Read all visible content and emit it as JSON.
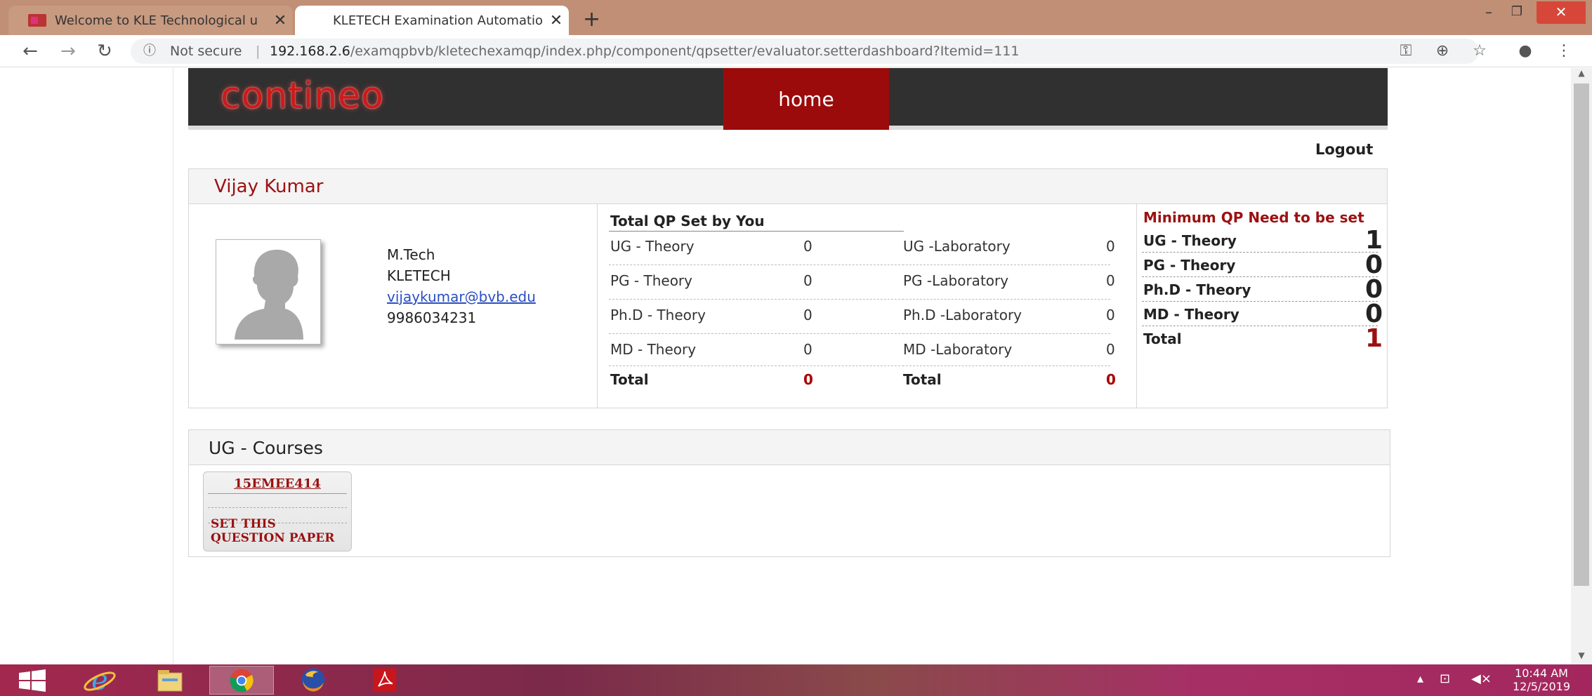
{
  "browser": {
    "tabs": [
      {
        "title": "Welcome to KLE Technological u",
        "close": "✕"
      },
      {
        "title": "KLETECH Examination Automatio",
        "close": "✕"
      }
    ],
    "new_tab": "+",
    "window": {
      "minimize": "–",
      "maximize": "❐",
      "close": "✕"
    },
    "security_label": "Not secure",
    "url_host": "192.168.2.6",
    "url_path": "/examqpbvb/kletechexamqp/index.php/component/qpsetter/evaluator.setterdashboard?Itemid=111"
  },
  "site": {
    "logo": "contineo",
    "nav_home": "home",
    "logout": "Logout"
  },
  "profile": {
    "name": "Vijay Kumar",
    "qualification": "M.Tech",
    "institution": "KLETECH",
    "email": "vijaykumar@bvb.edu",
    "phone": "9986034231"
  },
  "qp_set": {
    "title": "Total QP Set by You",
    "rows": [
      {
        "theory_label": "UG - Theory",
        "theory_value": "0",
        "lab_label": "UG -Laboratory",
        "lab_value": "0"
      },
      {
        "theory_label": "PG - Theory",
        "theory_value": "0",
        "lab_label": "PG -Laboratory",
        "lab_value": "0"
      },
      {
        "theory_label": "Ph.D - Theory",
        "theory_value": "0",
        "lab_label": "Ph.D -Laboratory",
        "lab_value": "0"
      },
      {
        "theory_label": "MD - Theory",
        "theory_value": "0",
        "lab_label": "MD -Laboratory",
        "lab_value": "0"
      }
    ],
    "total_label": "Total",
    "total_theory": "0",
    "total_lab": "0"
  },
  "minimum_qp": {
    "title": "Minimum QP Need to be set",
    "rows": [
      {
        "label": "UG - Theory",
        "value": "1"
      },
      {
        "label": "PG - Theory",
        "value": "0"
      },
      {
        "label": "Ph.D - Theory",
        "value": "0"
      },
      {
        "label": "MD - Theory",
        "value": "0"
      }
    ],
    "total_label": "Total",
    "total_value": "1"
  },
  "courses": {
    "title": "UG - Courses",
    "items": [
      {
        "code": "15EMEE414",
        "action": "SET THIS QUESTION PAPER"
      }
    ]
  },
  "taskbar": {
    "clock_time": "10:44 AM",
    "clock_date": "12/5/2019"
  },
  "colors": {
    "brand_red": "#9b1111",
    "header_dark": "#303030",
    "nav_active": "#9b0b0b"
  }
}
